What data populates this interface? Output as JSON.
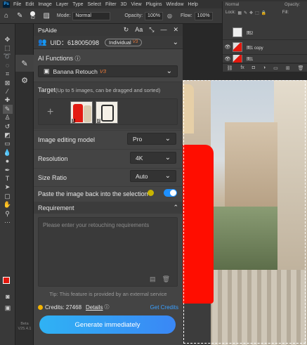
{
  "menubar": {
    "logo": "Ps",
    "items": [
      "File",
      "Edit",
      "Image",
      "Layer",
      "Type",
      "Select",
      "Filter",
      "3D",
      "View",
      "Plugins",
      "Window",
      "Help"
    ]
  },
  "options_bar": {
    "brush_size": "62",
    "mode_label": "Mode:",
    "mode_value": "Normal",
    "opacity_label": "Opacity:",
    "opacity_value": "100%",
    "flow_label": "Flow:",
    "flow_value": "100%"
  },
  "layers_panel": {
    "blend_mode": "Normal",
    "opacity_label": "Opacity:",
    "lock_label": "Lock:",
    "fill_label": "Fill:",
    "layers": [
      {
        "name": "图2",
        "visible": false
      },
      {
        "name": "图1 copy",
        "visible": true
      },
      {
        "name": "图1",
        "visible": true
      }
    ]
  },
  "plugin_strip": {
    "version": "Beta\nV25.4.1"
  },
  "plugin": {
    "title": "PsAide",
    "uid": "UID：618005098",
    "plan": "Individual",
    "plan_version": "V3",
    "ai_functions_label": "AI Functions",
    "function_value": "Banana Retouch",
    "function_version": "V3",
    "target_label": "Target",
    "target_hint": "(Up to 5 images, can be dragged and sorted)",
    "thumbnails": [
      {
        "num": "1"
      },
      {
        "num": "2"
      }
    ],
    "model_label": "Image editing model",
    "model_value": "Pro",
    "resolution_label": "Resolution",
    "resolution_value": "4K",
    "size_ratio_label": "Size Ratio",
    "size_ratio_value": "Auto",
    "paste_back_label": "Paste the image back into the selection",
    "paste_back_on": true,
    "requirement_label": "Requirement",
    "requirement_placeholder": "Please enter your retouching requirements",
    "tip": "Tip: This feature is provided by an external service",
    "credits_label": "Credits: 27468",
    "details_label": "Details",
    "get_credits_label": "Get Credits",
    "generate_label": "Generate immediately"
  },
  "colors": {
    "accent": "#3aa0ff",
    "generate_gradient_start": "#2fb2f4",
    "generate_gradient_end": "#3a87f5",
    "version_tag": "#f07c3a",
    "foreground_color": "#e3170d"
  }
}
